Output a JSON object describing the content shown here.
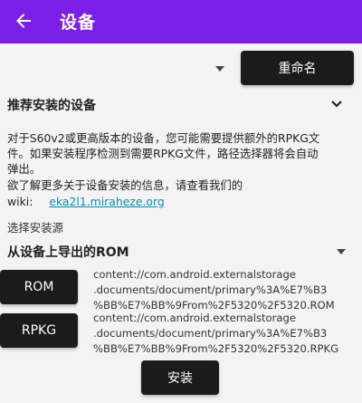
{
  "appbar": {
    "title": "设备"
  },
  "rename_button": "重命名",
  "recommend": {
    "title": "推荐安装的设备",
    "line1": "对于S60v2或更高版本的设备，您可能需要提供额外的RPKG文",
    "line2": "件。如果安装程序检测到需要RPKG文件，路径选择器将会自动",
    "line3": "弹出。",
    "line4": "欲了解更多关于设备安装的信息，请查看我们的",
    "wiki_prefix": "wiki:",
    "wiki_link": "eka2l1.miraheze.org"
  },
  "source": {
    "label": "选择安装源",
    "selected": "从设备上导出的ROM"
  },
  "rom": {
    "button": "ROM",
    "path_line1": "content://com.android.externalstorage",
    "path_line2": ".documents/document/primary%3A%E7%B3",
    "path_line3": "%BB%E7%BB%9From%2F5320%2F5320.ROM"
  },
  "rpkg": {
    "button": "RPKG",
    "path_line1": "content://com.android.externalstorage",
    "path_line2": ".documents/document/primary%3A%E7%B3",
    "path_line3": "%BB%E7%BB%9From%2F5320%2F5320.RPKG"
  },
  "install_button": "安装",
  "colors": {
    "appbar": "#7a1fe6",
    "button": "#1b1b1b",
    "link": "#0b8fa3"
  }
}
